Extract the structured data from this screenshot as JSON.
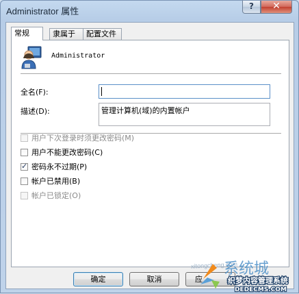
{
  "window": {
    "title": "Administrator 属性",
    "help_glyph": "?",
    "close_glyph": "✕"
  },
  "tabs": [
    {
      "label": "常规"
    },
    {
      "label": "隶属于"
    },
    {
      "label": "配置文件"
    }
  ],
  "user": {
    "name": "Administrator",
    "icon": "user-account-icon"
  },
  "fields": {
    "fullname_label": "全名(F):",
    "fullname_value": "",
    "desc_label": "描述(D):",
    "desc_value": "管理计算机(域)的内置帐户"
  },
  "checkboxes": [
    {
      "label": "用户下次登录时须更改密码(M)",
      "checked": false,
      "disabled": true
    },
    {
      "label": "用户不能更改密码(C)",
      "checked": false,
      "disabled": false
    },
    {
      "label": "密码永不过期(P)",
      "checked": true,
      "disabled": false
    },
    {
      "label": "帐户已禁用(B)",
      "checked": false,
      "disabled": false
    },
    {
      "label": "帐户已锁定(O)",
      "checked": false,
      "disabled": true
    }
  ],
  "buttons": {
    "ok": "确定",
    "cancel": "取消",
    "apply_visible": "应"
  },
  "check_glyph": "✓",
  "watermark": {
    "domain": "xitongcheng.com",
    "logo_word": "系统城",
    "brand": "织梦内容管理系统",
    "brand_url": "DEDECMS.COM"
  },
  "colors": {
    "accent": "#3c7fb1",
    "title_bg": "#b7cde7",
    "close_red": "#c2402f"
  }
}
